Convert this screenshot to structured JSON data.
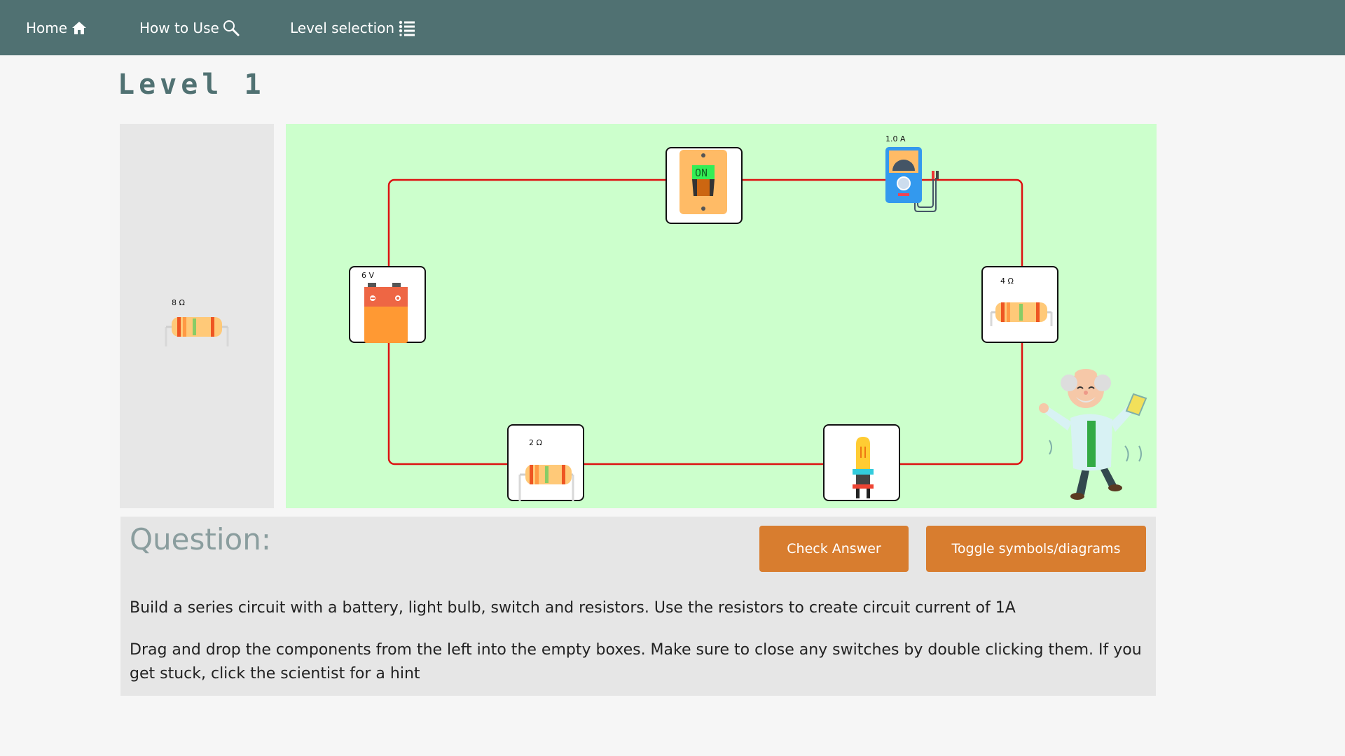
{
  "nav": {
    "home": {
      "label": "Home",
      "icon": "home-icon"
    },
    "how_to_use": {
      "label": "How to Use",
      "icon": "search-icon"
    },
    "level_selection": {
      "label": "Level selection",
      "icon": "list-icon"
    }
  },
  "page_title": "Level 1",
  "palette": {
    "items": [
      {
        "type": "resistor",
        "label": "8 Ω"
      }
    ]
  },
  "circuit": {
    "battery": {
      "label": "6 V"
    },
    "switch": {
      "state_label": "ON"
    },
    "ammeter": {
      "reading": "1.0 A"
    },
    "resistor_right": {
      "label": "4 Ω"
    },
    "resistor_bottom": {
      "label": "2 Ω"
    },
    "bulb": {
      "label": ""
    }
  },
  "question": {
    "heading": "Question:",
    "check_button": "Check Answer",
    "toggle_button": "Toggle symbols/diagrams",
    "text1": "Build a series circuit with a battery, light bulb, switch and resistors. Use the resistors to create circuit current of 1A",
    "text2": "Drag and drop the components from the left into the empty boxes. Make sure to close any switches by double clicking them. If you get stuck, click the scientist for a hint"
  },
  "colors": {
    "navbar": "#507172",
    "board": "#ccffcc",
    "wire": "#dd1111",
    "button": "#d87d2f"
  }
}
